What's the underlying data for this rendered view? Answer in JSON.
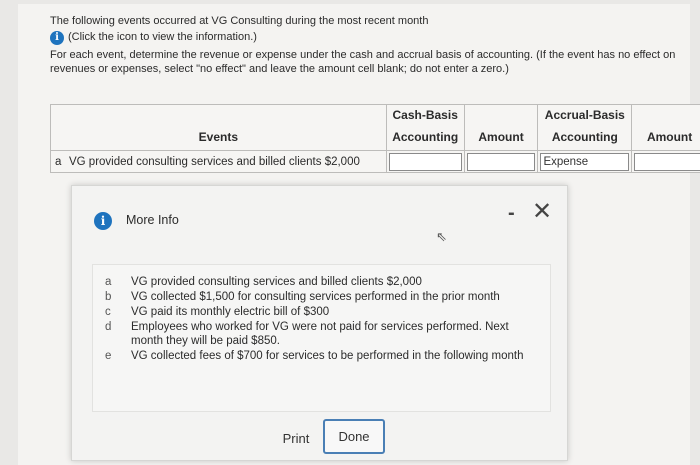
{
  "intro": {
    "line1": "The following events occurred at VG Consulting during the most recent month",
    "click_hint": "(Click the icon to view the information.)",
    "instructions": "For each event, determine the revenue or expense under the cash and accrual basis of accounting. (If the event has no effect on revenues or expenses, select \"no effect\" and leave the amount cell blank; do not enter a zero.)"
  },
  "table": {
    "headers": {
      "events": "Events",
      "cash_1": "Cash-Basis",
      "cash_2": "Accounting",
      "amount_1": "Amount",
      "accrual_1": "Accrual-Basis",
      "accrual_2": "Accounting",
      "amount_2": "Amount"
    },
    "rows": [
      {
        "letter": "a",
        "event": "VG provided consulting services and billed clients $2,000",
        "cash_basis": "",
        "cash_amount": "",
        "accrual_basis": "Expense",
        "accrual_amount": ""
      }
    ]
  },
  "modal": {
    "title": "More Info",
    "minimize": "-",
    "close": "✕",
    "items": [
      {
        "letter": "a",
        "text": "VG provided consulting services and billed clients $2,000"
      },
      {
        "letter": "b",
        "text": "VG collected $1,500 for consulting services performed in the prior month"
      },
      {
        "letter": "c",
        "text": "VG paid its monthly electric bill of $300"
      },
      {
        "letter": "d",
        "text": "Employees who worked for VG were not paid for services performed. Next month they will be paid $850."
      },
      {
        "letter": "e",
        "text": "VG collected fees of $700 for services to be performed in the following month"
      }
    ],
    "print_label": "Print",
    "done_label": "Done"
  },
  "colors": {
    "info_icon": "#1e73be",
    "done_border": "#4a7fb5"
  }
}
